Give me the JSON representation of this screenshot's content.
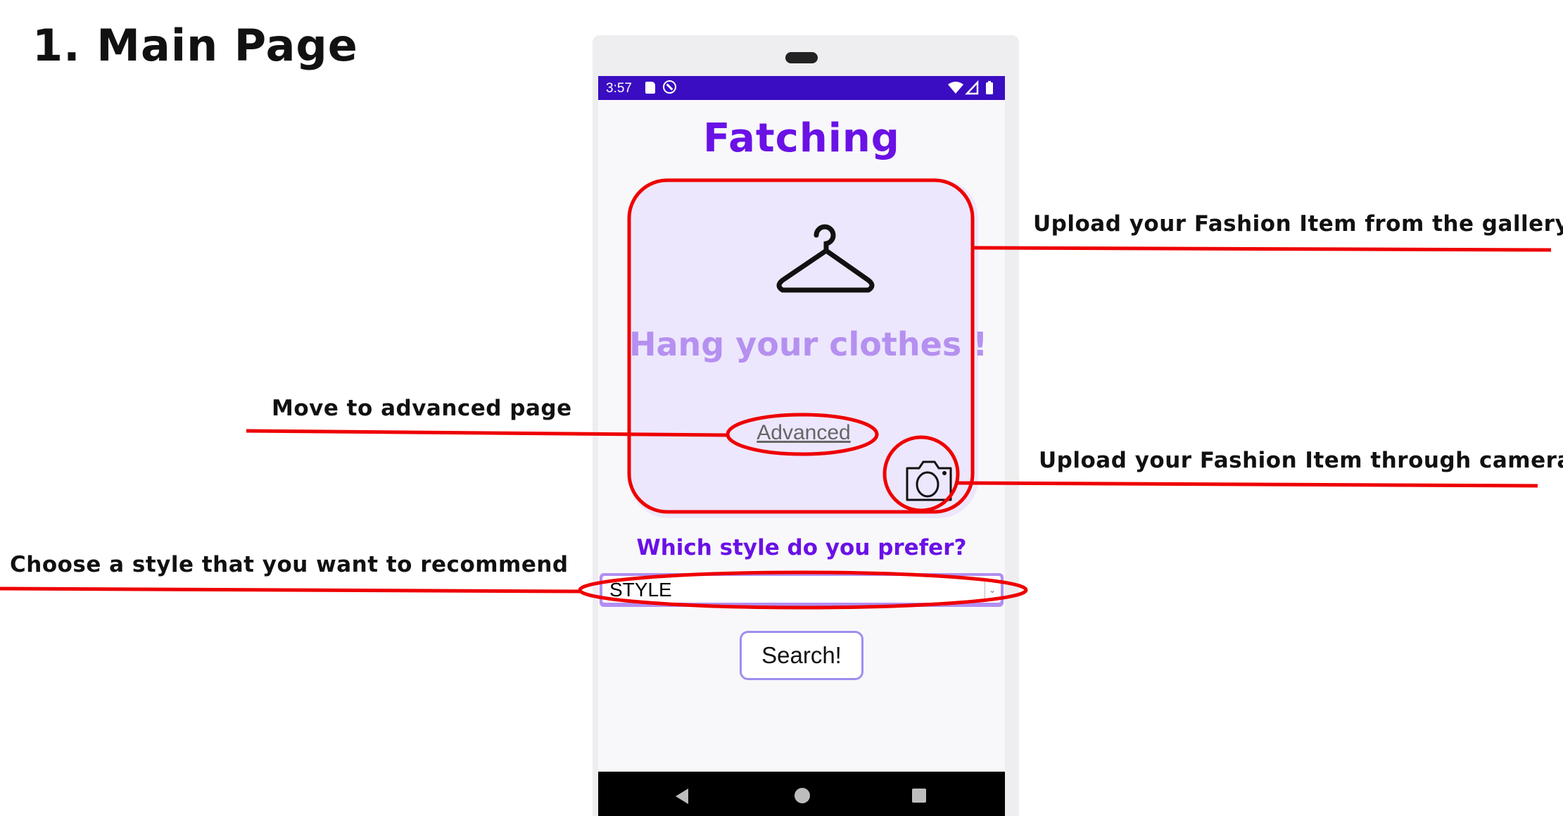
{
  "page_heading": "1. Main Page",
  "annotations": {
    "gallery": "Upload your Fashion Item from the gallery",
    "camera": "Upload your Fashion Item through camera",
    "advanced": "Move to advanced page",
    "style": "Choose a style that you want to recommend"
  },
  "status_bar": {
    "time": "3:57"
  },
  "app": {
    "title": "Fatching",
    "upload_card": {
      "text": "Hang your clothes !",
      "advanced_link": "Advanced"
    },
    "style_question": "Which style do you prefer?",
    "style_select": {
      "value": "STYLE"
    },
    "search_button": "Search!"
  },
  "icons": [
    "hanger-icon",
    "camera-icon",
    "sd-card-icon",
    "dnd-icon",
    "wifi-icon",
    "signal-icon",
    "battery-icon",
    "back-icon",
    "home-icon",
    "recents-icon"
  ],
  "colors": {
    "accent": "#6a11e6",
    "status_bar": "#3a0cc2",
    "card": "#ede7fd",
    "annotation": "#ff0000"
  }
}
